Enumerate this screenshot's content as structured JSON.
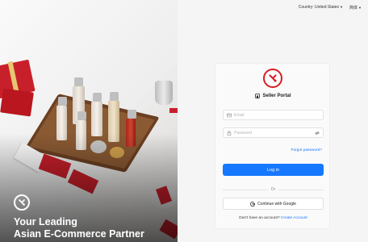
{
  "hero": {
    "line1": "Your Leading",
    "line2": "Asian E-Commerce Partner",
    "logo_icon": "brand-logo-icon",
    "accent_color": "#d91c24"
  },
  "topbar": {
    "country_label": "Country: United States",
    "language_label": "简体"
  },
  "login": {
    "title": "Seller Portal",
    "email_placeholder": "Email",
    "password_placeholder": "Password",
    "forgot_label": "Forgot password?",
    "login_label": "Log in",
    "or_label": "Or",
    "google_label": "Continue with Google",
    "signup_prompt": "Don't have an account?",
    "signup_link": "Create Account",
    "primary_color": "#1677ff"
  }
}
